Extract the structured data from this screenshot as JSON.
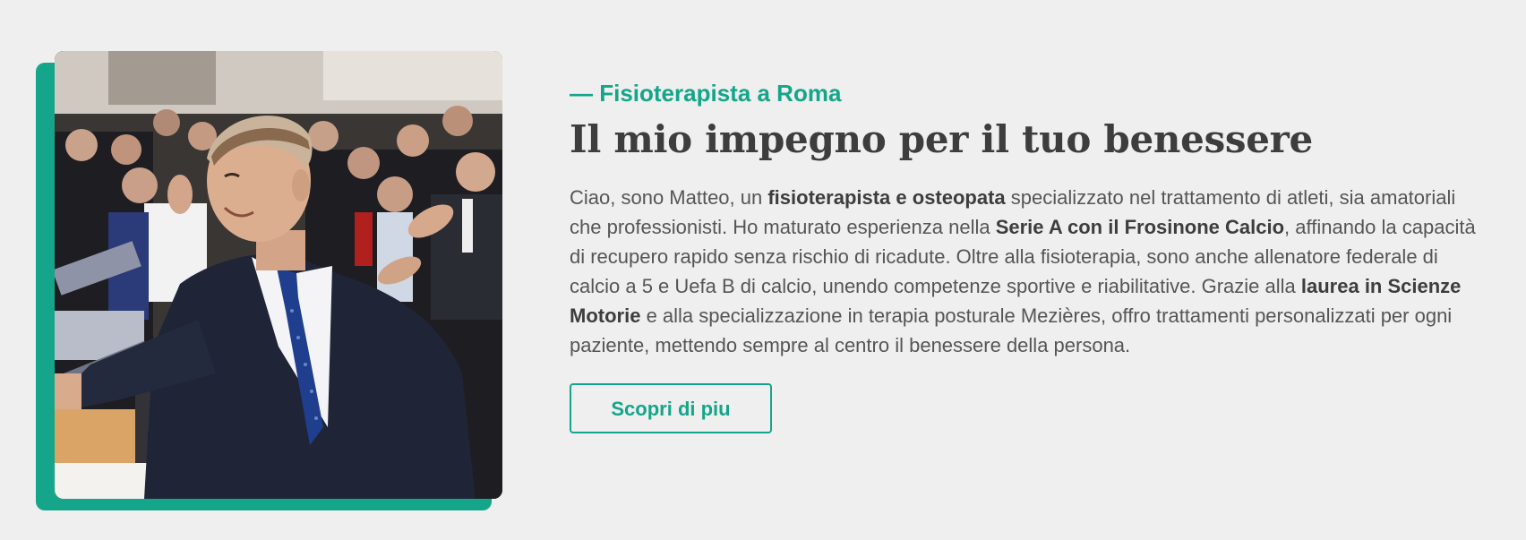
{
  "colors": {
    "accent": "#15a58a",
    "background": "#eeefee",
    "heading": "#3d3d3d",
    "body_text": "#555555"
  },
  "about": {
    "eyebrow": "— Fisioterapista a Roma",
    "title": "Il mio impegno per il tuo benessere",
    "bio": {
      "p1": "Ciao, sono Matteo, un ",
      "b1": "fisioterapista e osteopata",
      "p2": " specializzato nel trattamento di atleti, sia amatoriali che professionisti. Ho maturato esperienza nella ",
      "b2": "Serie A con il Frosinone Calcio",
      "p3": ", affinando la capacità di recupero rapido senza rischio di ricadute. Oltre alla fisioterapia, sono anche allenatore federale di calcio a 5 e Uefa B di calcio, unendo competenze sportive e riabilitative. Grazie alla ",
      "b3": "laurea in Scienze Motorie",
      "p4": " e alla specializzazione in terapia posturale Mezières, offro trattamenti personalizzati per ogni paziente, mettendo sempre al centro il benessere della persona."
    },
    "cta_label": "Scopri di piu",
    "photo_icon": "portrait-photo"
  }
}
